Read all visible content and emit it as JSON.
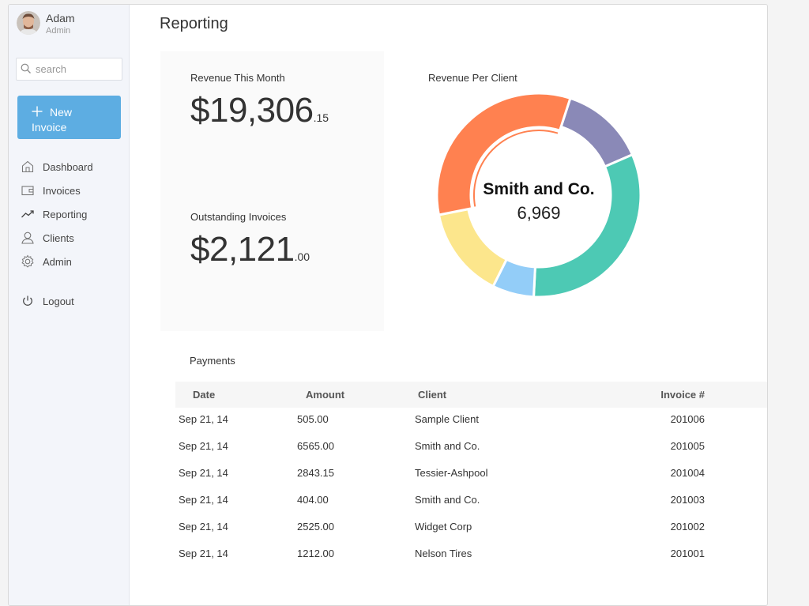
{
  "user": {
    "name": "Adam",
    "role": "Admin"
  },
  "search": {
    "placeholder": "search"
  },
  "new_invoice": {
    "line1": "New",
    "line2": "Invoice"
  },
  "nav": {
    "items": [
      {
        "label": "Dashboard",
        "icon": "home-icon"
      },
      {
        "label": "Invoices",
        "icon": "wallet-icon"
      },
      {
        "label": "Reporting",
        "icon": "trend-icon"
      },
      {
        "label": "Clients",
        "icon": "user-icon"
      },
      {
        "label": "Admin",
        "icon": "gear-icon"
      }
    ],
    "logout": "Logout"
  },
  "page": {
    "title": "Reporting"
  },
  "stats": {
    "revenue": {
      "label": "Revenue This Month",
      "whole": "$19,306",
      "cents": ".15"
    },
    "outstanding": {
      "label": "Outstanding Invoices",
      "whole": "$2,121",
      "cents": ".00"
    }
  },
  "chart": {
    "label": "Revenue Per Client",
    "center_name": "Smith and Co.",
    "center_value": "6,969"
  },
  "chart_data": {
    "type": "pie",
    "title": "Revenue Per Client",
    "slices": [
      {
        "value": 13.5,
        "color": "#8a89b7"
      },
      {
        "value": 32.3,
        "color": "#4dc9b4"
      },
      {
        "value": 6.6,
        "color": "#93cdf8"
      },
      {
        "value": 14.5,
        "color": "#fce68c"
      },
      {
        "value": 33.1,
        "color": "#ff8150"
      }
    ],
    "highlighted_slice_index": 4,
    "center_label": "Smith and Co.",
    "center_value": 6969
  },
  "payments": {
    "title": "Payments",
    "columns": [
      "Date",
      "Amount",
      "Client",
      "Invoice #"
    ],
    "rows": [
      [
        "Sep 21, 14",
        "505.00",
        "Sample Client",
        "201006"
      ],
      [
        "Sep 21, 14",
        "6565.00",
        "Smith and Co.",
        "201005"
      ],
      [
        "Sep 21, 14",
        "2843.15",
        "Tessier-Ashpool",
        "201004"
      ],
      [
        "Sep 21, 14",
        "404.00",
        "Smith and Co.",
        "201003"
      ],
      [
        "Sep 21, 14",
        "2525.00",
        "Widget Corp",
        "201002"
      ],
      [
        "Sep 21, 14",
        "1212.00",
        "Nelson Tires",
        "201001"
      ]
    ]
  }
}
